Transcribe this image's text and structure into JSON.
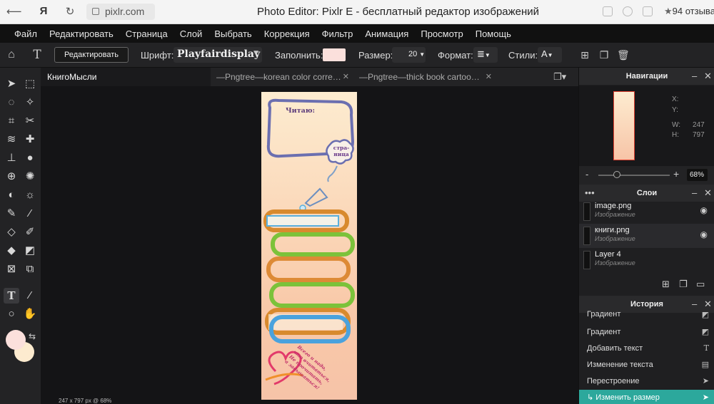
{
  "browser": {
    "url": "pixlr.com",
    "title": "Photo Editor: Pixlr E - бесплатный редактор изображений",
    "reviews": "94 отзыва",
    "yandex_glyph": "Я"
  },
  "menu": [
    "Файл",
    "Редактировать",
    "Страница",
    "Слой",
    "Выбрать",
    "Коррекция",
    "Фильтр",
    "Анимация",
    "Просмотр",
    "Помощь"
  ],
  "toolbar": {
    "edit_button": "Редактировать",
    "font_label": "Шрифт:",
    "font_value": "Playfairdisplay",
    "fill_label": "Заполнить:",
    "fill_color": "#fbe0dc",
    "size_label": "Размер:",
    "size_value": "20",
    "format_label": "Формат:",
    "styles_label": "Стили:"
  },
  "tabs": [
    {
      "label": "КнигоМысли"
    },
    {
      "label": "—Pngtree—korean color corre…"
    },
    {
      "label": "—Pngtree—thick book cartoo…"
    }
  ],
  "canvas": {
    "status": "247 x 797 px @ 68%",
    "text_reading": "Читаю:",
    "text_page_1": "стра-",
    "text_page_2": "ница",
    "quote": [
      "Всего и надо,",
      "что вчитаться,",
      "Не прочитать,",
      "а задышаться!"
    ]
  },
  "navigator": {
    "title": "Навигации",
    "x_label": "X:",
    "y_label": "Y:",
    "w_label": "W:",
    "w_value": "247",
    "h_label": "H:",
    "h_value": "797",
    "zoom": "68%"
  },
  "layers": {
    "title": "Слои",
    "items": [
      {
        "name": "image.png",
        "type": "Изображение"
      },
      {
        "name": "книги.png",
        "type": "Изображение"
      },
      {
        "name": "Layer 4",
        "type": "Изображение"
      }
    ]
  },
  "history": {
    "title": "История",
    "items": [
      {
        "label": "Градиент"
      },
      {
        "label": "Градиент"
      },
      {
        "label": "Добавить текст"
      },
      {
        "label": "Изменение текста"
      },
      {
        "label": "Перестроение"
      },
      {
        "label": "↳ Изменить размер"
      }
    ]
  },
  "colors": {
    "accent": "#2ca89c",
    "primary_swatch": "#fbe0dc",
    "secondary_swatch": "#fdebcf"
  }
}
